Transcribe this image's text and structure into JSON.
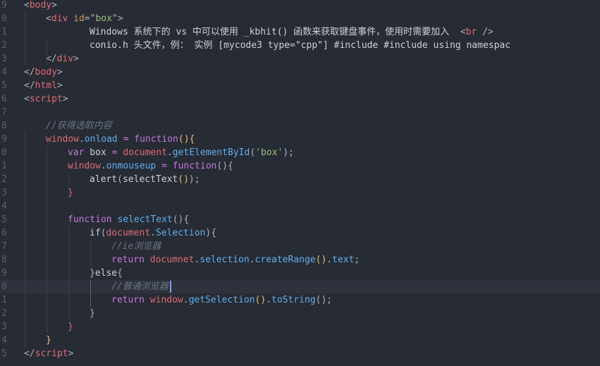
{
  "editor": {
    "theme_colors": {
      "background": "#272b34",
      "tag": "#e06c75",
      "keyword": "#c678dd",
      "function": "#61afef",
      "string": "#98c379",
      "comment": "#6b7385"
    },
    "lines": [
      {
        "num": "9",
        "indent": 0,
        "tokens": [
          {
            "c": "pun",
            "t": "<"
          },
          {
            "c": "tag",
            "t": "body"
          },
          {
            "c": "pun",
            "t": ">"
          }
        ]
      },
      {
        "num": "0",
        "indent": 1,
        "tokens": [
          {
            "c": "pun",
            "t": "<"
          },
          {
            "c": "tag",
            "t": "div"
          },
          {
            "c": "txt",
            "t": " "
          },
          {
            "c": "attr",
            "t": "id"
          },
          {
            "c": "pun",
            "t": "="
          },
          {
            "c": "str",
            "t": "\"box\""
          },
          {
            "c": "pun",
            "t": ">"
          }
        ]
      },
      {
        "num": "1",
        "indent": 3,
        "tokens": [
          {
            "c": "txt",
            "t": "Windows 系统下的 vs 中可以使用 _kbhit() 函数来获取键盘事件，使用时需要加入  "
          },
          {
            "c": "pun",
            "t": "<"
          },
          {
            "c": "tag",
            "t": "br"
          },
          {
            "c": "pun",
            "t": " />"
          }
        ]
      },
      {
        "num": "2",
        "indent": 3,
        "tokens": [
          {
            "c": "txt",
            "t": "conio.h 头文件，例： 实例 [mycode3 type=\"cpp\"] #include #include using namespac"
          }
        ]
      },
      {
        "num": "3",
        "indent": 1,
        "tokens": [
          {
            "c": "pun",
            "t": "</"
          },
          {
            "c": "tag",
            "t": "div"
          },
          {
            "c": "pun",
            "t": ">"
          }
        ]
      },
      {
        "num": "4",
        "indent": 0,
        "tokens": [
          {
            "c": "pun",
            "t": "</"
          },
          {
            "c": "tag",
            "t": "body"
          },
          {
            "c": "pun",
            "t": ">"
          }
        ]
      },
      {
        "num": "5",
        "indent": 0,
        "tokens": [
          {
            "c": "pun",
            "t": "</"
          },
          {
            "c": "tag",
            "t": "html"
          },
          {
            "c": "pun",
            "t": ">"
          }
        ]
      },
      {
        "num": "6",
        "indent": 0,
        "tokens": [
          {
            "c": "pun",
            "t": "<"
          },
          {
            "c": "tag",
            "t": "script"
          },
          {
            "c": "pun",
            "t": ">"
          }
        ]
      },
      {
        "num": "7",
        "indent": 0,
        "tokens": []
      },
      {
        "num": "8",
        "indent": 1,
        "tokens": [
          {
            "c": "cmt",
            "t": "//获得选取内容"
          }
        ]
      },
      {
        "num": "9",
        "indent": 1,
        "tokens": [
          {
            "c": "tag",
            "t": "window"
          },
          {
            "c": "pun",
            "t": "."
          },
          {
            "c": "fn",
            "t": "onload"
          },
          {
            "c": "txt",
            "t": " "
          },
          {
            "c": "kw",
            "t": "="
          },
          {
            "c": "txt",
            "t": " "
          },
          {
            "c": "kw",
            "t": "function"
          },
          {
            "c": "brk",
            "t": "(){"
          }
        ]
      },
      {
        "num": "0",
        "indent": 2,
        "tokens": [
          {
            "c": "kw",
            "t": "var"
          },
          {
            "c": "txt",
            "t": " box "
          },
          {
            "c": "kw",
            "t": "="
          },
          {
            "c": "txt",
            "t": " "
          },
          {
            "c": "tag",
            "t": "document"
          },
          {
            "c": "pun",
            "t": "."
          },
          {
            "c": "fn",
            "t": "getElementById"
          },
          {
            "c": "pun",
            "t": "("
          },
          {
            "c": "str",
            "t": "'box'"
          },
          {
            "c": "pun",
            "t": ");"
          }
        ]
      },
      {
        "num": "1",
        "indent": 2,
        "tokens": [
          {
            "c": "tag",
            "t": "window"
          },
          {
            "c": "pun",
            "t": "."
          },
          {
            "c": "fn",
            "t": "onmouseup"
          },
          {
            "c": "txt",
            "t": " "
          },
          {
            "c": "kw",
            "t": "="
          },
          {
            "c": "txt",
            "t": " "
          },
          {
            "c": "kw",
            "t": "function"
          },
          {
            "c": "pun",
            "t": "(){"
          }
        ]
      },
      {
        "num": "2",
        "indent": 3,
        "tokens": [
          {
            "c": "txt",
            "t": "alert"
          },
          {
            "c": "pun",
            "t": "("
          },
          {
            "c": "txt",
            "t": "selectText"
          },
          {
            "c": "brk",
            "t": "()"
          },
          {
            "c": "pun",
            "t": ");"
          }
        ]
      },
      {
        "num": "3",
        "indent": 2,
        "tokens": [
          {
            "c": "tag",
            "t": "}"
          }
        ]
      },
      {
        "num": "4",
        "indent": 0,
        "tokens": []
      },
      {
        "num": "5",
        "indent": 2,
        "tokens": [
          {
            "c": "kw",
            "t": "function"
          },
          {
            "c": "txt",
            "t": " "
          },
          {
            "c": "fn",
            "t": "selectText"
          },
          {
            "c": "pun",
            "t": "(){"
          }
        ]
      },
      {
        "num": "6",
        "indent": 3,
        "tokens": [
          {
            "c": "txt",
            "t": "if"
          },
          {
            "c": "pun",
            "t": "("
          },
          {
            "c": "tag",
            "t": "document"
          },
          {
            "c": "pun",
            "t": "."
          },
          {
            "c": "fn",
            "t": "Selection"
          },
          {
            "c": "pun",
            "t": "){"
          }
        ]
      },
      {
        "num": "7",
        "indent": 4,
        "tokens": [
          {
            "c": "cmt",
            "t": "//ie浏览器"
          }
        ]
      },
      {
        "num": "8",
        "indent": 4,
        "tokens": [
          {
            "c": "kw",
            "t": "return"
          },
          {
            "c": "txt",
            "t": " "
          },
          {
            "c": "tag",
            "t": "documnet"
          },
          {
            "c": "pun",
            "t": "."
          },
          {
            "c": "fn",
            "t": "selection"
          },
          {
            "c": "pun",
            "t": "."
          },
          {
            "c": "fn",
            "t": "createRange"
          },
          {
            "c": "brk",
            "t": "()"
          },
          {
            "c": "pun",
            "t": "."
          },
          {
            "c": "fn",
            "t": "text"
          },
          {
            "c": "pun",
            "t": ";"
          }
        ]
      },
      {
        "num": "9",
        "indent": 3,
        "tokens": [
          {
            "c": "pun",
            "t": "}"
          },
          {
            "c": "txt",
            "t": "else"
          },
          {
            "c": "pun",
            "t": "{"
          }
        ]
      },
      {
        "num": "0",
        "indent": 4,
        "tokens": [
          {
            "c": "cmt",
            "t": "//普通浏览器"
          }
        ]
      },
      {
        "num": "1",
        "indent": 4,
        "tokens": [
          {
            "c": "kw",
            "t": "return"
          },
          {
            "c": "txt",
            "t": " "
          },
          {
            "c": "tag",
            "t": "window"
          },
          {
            "c": "pun",
            "t": "."
          },
          {
            "c": "fn",
            "t": "getSelection"
          },
          {
            "c": "brk",
            "t": "()"
          },
          {
            "c": "pun",
            "t": "."
          },
          {
            "c": "fn",
            "t": "toString"
          },
          {
            "c": "pun",
            "t": "();"
          }
        ]
      },
      {
        "num": "2",
        "indent": 3,
        "tokens": [
          {
            "c": "pun",
            "t": "}"
          }
        ]
      },
      {
        "num": "3",
        "indent": 2,
        "tokens": [
          {
            "c": "tag",
            "t": "}"
          }
        ]
      },
      {
        "num": "4",
        "indent": 1,
        "tokens": [
          {
            "c": "brk",
            "t": "}"
          }
        ]
      },
      {
        "num": "5",
        "indent": 0,
        "tokens": [
          {
            "c": "pun",
            "t": "</"
          },
          {
            "c": "tag",
            "t": "script"
          },
          {
            "c": "pun",
            "t": ">"
          }
        ]
      }
    ]
  }
}
